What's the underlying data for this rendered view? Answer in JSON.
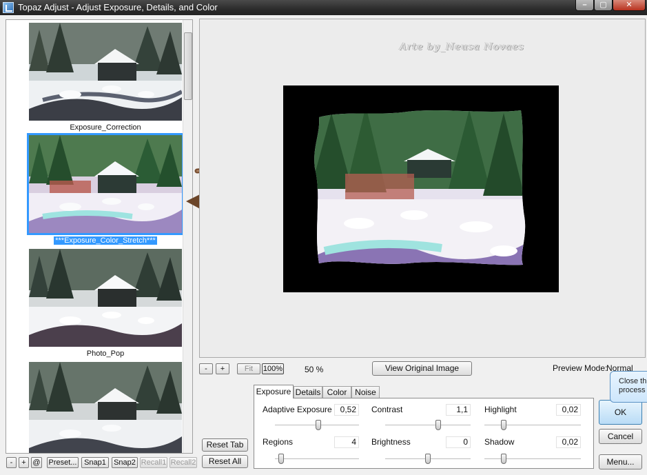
{
  "window": {
    "title": "Topaz Adjust - Adjust Exposure, Details, and Color",
    "min_label": "–",
    "max_label": "▢",
    "close_label": "✕"
  },
  "presets": {
    "items": [
      {
        "label": "Exposure_Correction",
        "selected": false
      },
      {
        "label": "***Exposure_Color_Stretch***",
        "selected": true
      },
      {
        "label": "Photo_Pop",
        "selected": false
      },
      {
        "label": "",
        "selected": false
      }
    ]
  },
  "preset_toolbar": {
    "minus": "-",
    "plus": "+",
    "at": "@",
    "preset": "Preset...",
    "snap1": "Snap1",
    "snap2": "Snap2",
    "recall1": "Recall1",
    "recall2": "Recall2"
  },
  "preview": {
    "watermark": "Arte by_Neusa Novaes",
    "zoom_out": "-",
    "zoom_in": "+",
    "fit": "Fit",
    "hundred": "100%",
    "zoom_level": "50 %",
    "view_original": "View Original Image",
    "mode_label": "Preview Mode:",
    "mode_value": "Normal"
  },
  "tabs": {
    "exposure": "Exposure",
    "details": "Details",
    "color": "Color",
    "noise": "Noise"
  },
  "params": {
    "adaptive_exposure": {
      "label": "Adaptive Exposure",
      "value": "0,52",
      "slider": 0.52
    },
    "contrast": {
      "label": "Contrast",
      "value": "1,1",
      "slider": 0.62
    },
    "highlight": {
      "label": "Highlight",
      "value": "0,02",
      "slider": 0.2
    },
    "regions": {
      "label": "Regions",
      "value": "4",
      "slider": 0.07
    },
    "brightness": {
      "label": "Brightness",
      "value": "0",
      "slider": 0.5
    },
    "shadow": {
      "label": "Shadow",
      "value": "0,02",
      "slider": 0.2
    }
  },
  "buttons": {
    "reset_tab": "Reset Tab",
    "reset_all": "Reset All",
    "ok": "OK",
    "cancel": "Cancel",
    "menu": "Menu..."
  },
  "tooltip": {
    "line1": "Close th",
    "line2": "process"
  }
}
